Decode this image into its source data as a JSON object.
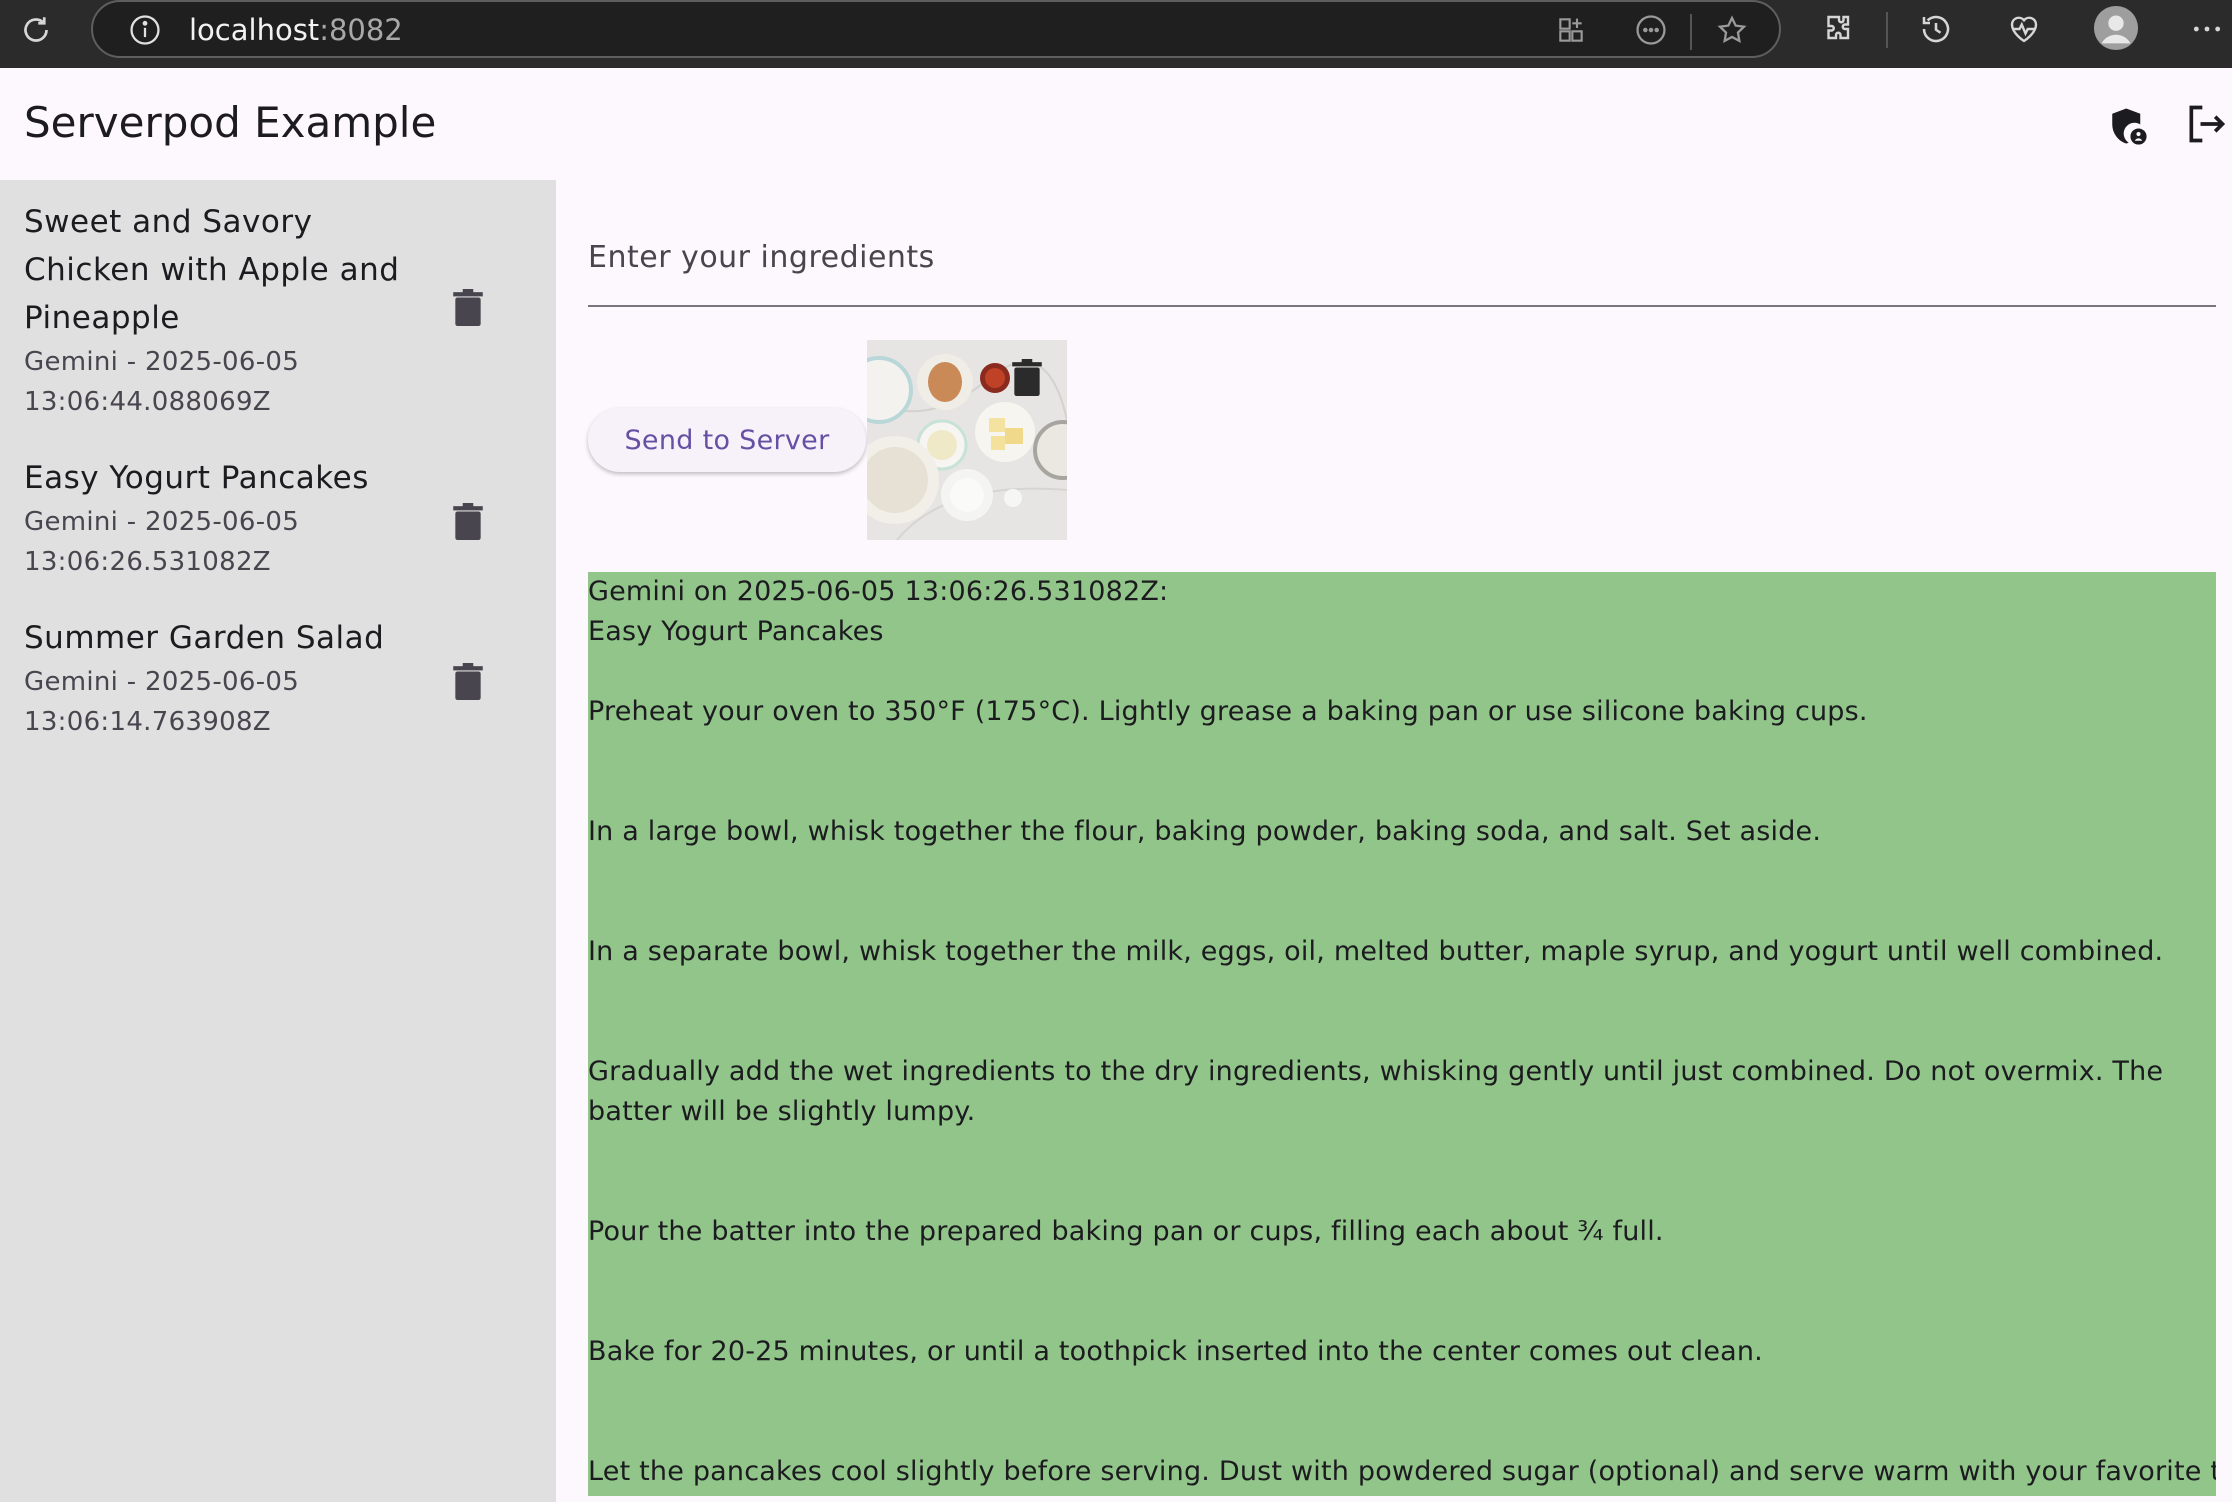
{
  "browser": {
    "url_host": "localhost",
    "url_port": ":8082",
    "icons": [
      "reload-icon",
      "site-info-icon",
      "app-grid-icon",
      "more-circle-icon",
      "favorite-star-icon",
      "extensions-icon",
      "history-icon",
      "health-icon",
      "profile-avatar-icon",
      "more-menu-icon"
    ]
  },
  "app": {
    "title": "Serverpod Example",
    "actions": [
      "security-shield-icon",
      "logout-icon"
    ]
  },
  "sidebar": {
    "items": [
      {
        "title": "Sweet and Savory Chicken with Apple and Pineapple",
        "subtitle": "Gemini - 2025-06-05 13:06:44.088069Z"
      },
      {
        "title": "Easy Yogurt Pancakes",
        "subtitle": "Gemini - 2025-06-05 13:06:26.531082Z"
      },
      {
        "title": "Summer Garden Salad",
        "subtitle": "Gemini - 2025-06-05 13:06:14.763908Z"
      }
    ]
  },
  "main": {
    "ingredients_placeholder": "Enter your ingredients",
    "send_label": "Send to Server",
    "response_color": "#91c58a",
    "response_lines": [
      "Gemini on 2025-06-05 13:06:26.531082Z:",
      "Easy Yogurt Pancakes",
      "Preheat your oven to 350°F (175°C). Lightly grease a baking pan or use silicone baking cups.",
      "In a large bowl, whisk together the flour, baking powder, baking soda, and salt.  Set aside.",
      "In a separate bowl, whisk together the milk, eggs, oil, melted butter, maple syrup, and yogurt until well combined.",
      "Gradually add the wet ingredients to the dry ingredients, whisking gently until just combined. Do not overmix. The batter will be slightly lumpy.",
      "Pour the batter into the prepared baking pan or cups, filling each about ¾ full.",
      "Bake for 20-25 minutes, or until a toothpick inserted into the center comes out clean.",
      "Let the pancakes cool slightly before serving. Dust with powdered sugar (optional) and serve warm with your favorite toppings,"
    ]
  }
}
